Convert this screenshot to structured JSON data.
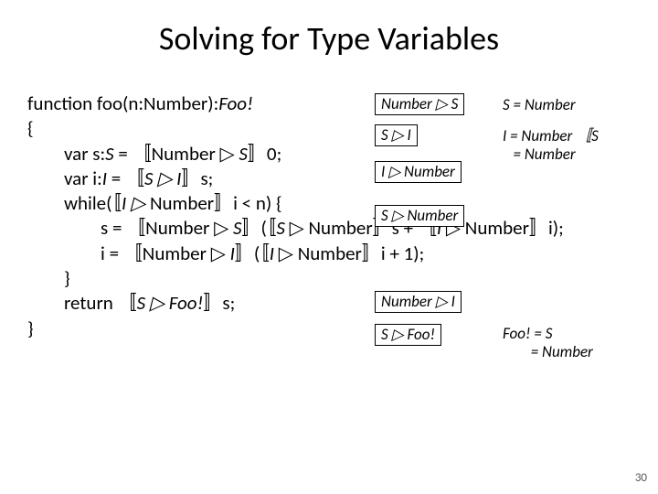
{
  "title": "Solving for Type Variables",
  "code": {
    "l1_a": "function foo(n:Number):",
    "l1_b": "Foo!",
    "l2": "{",
    "l3_a": "var s:",
    "l3_b": "S",
    "l3_c": " = 〚Number ▷ ",
    "l3_d": "S",
    "l3_e": "〛0;",
    "l4_a": "var i:",
    "l4_b": "I",
    "l4_c": " = 〚",
    "l4_d": "S ▷ I",
    "l4_e": "〛s;",
    "l5_a": "while(〚",
    "l5_b": "I ▷",
    "l5_c": " Number〛i < n) {",
    "l6_a": "s = 〚Number ▷ ",
    "l6_b": "S",
    "l6_c": "〛(〚",
    "l6_d": "S",
    "l6_e": " ▷ Number〛s + 〚",
    "l6_f": "I",
    "l6_g": " ▷ Number〛i);",
    "l7_a": "i = 〚Number ▷ ",
    "l7_b": "I",
    "l7_c": "〛(〚",
    "l7_d": "I",
    "l7_e": " ▷ Number〛i + 1);",
    "l8": "}",
    "l9_a": "return 〚",
    "l9_b": "S ▷ Foo!",
    "l9_c": "〛s;",
    "l10": "}"
  },
  "anno": {
    "a1": "Number ▷ S",
    "a2": "S ▷ I",
    "a3": "I ▷ Number",
    "a4": "S ▷ Number",
    "a5": "Number ▷ I",
    "a6": "S ▷ Foo!",
    "r1": "S = Number",
    "r2a": "I = Number 〚S",
    "r2b": "   = Number",
    "r3a": "Foo! = S",
    "r3b": "        = Number"
  },
  "pagenum": "30"
}
